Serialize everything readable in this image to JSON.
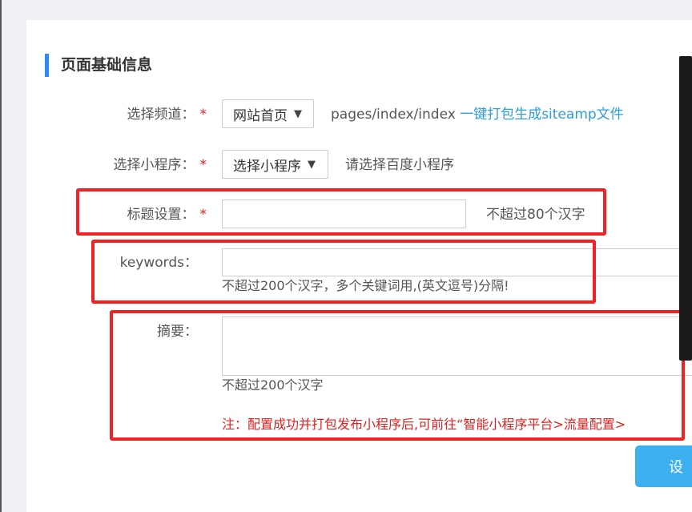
{
  "section": {
    "title": "页面基础信息"
  },
  "form": {
    "channel": {
      "label": "选择频道：",
      "required_mark": "*",
      "selected": "网站首页",
      "path": "pages/index/index",
      "action_link": "一键打包生成siteamp文件"
    },
    "miniprogram": {
      "label": "选择小程序：",
      "required_mark": "*",
      "selected": "选择小程序",
      "hint": "请选择百度小程序"
    },
    "title": {
      "label": "标题设置：",
      "required_mark": "*",
      "value": "",
      "hint": "不超过80个汉字"
    },
    "keywords": {
      "label": "keywords：",
      "value": "",
      "hint": "不超过200个汉字，多个关键词用,(英文逗号)分隔!"
    },
    "summary": {
      "label": "摘要：",
      "value": "",
      "hint": "不超过200个汉字",
      "note": "注：配置成功并打包发布小程序后,可前往“智能小程序平台>流量配置>"
    }
  },
  "actions": {
    "save_label": "设"
  },
  "icons": {
    "dropdown": "caret-down-icon"
  },
  "colors": {
    "accent": "#2d8cf0",
    "link": "#2d9cdb",
    "required": "#e02020",
    "annotation": "#ef2323",
    "button": "#3fb0ef"
  }
}
